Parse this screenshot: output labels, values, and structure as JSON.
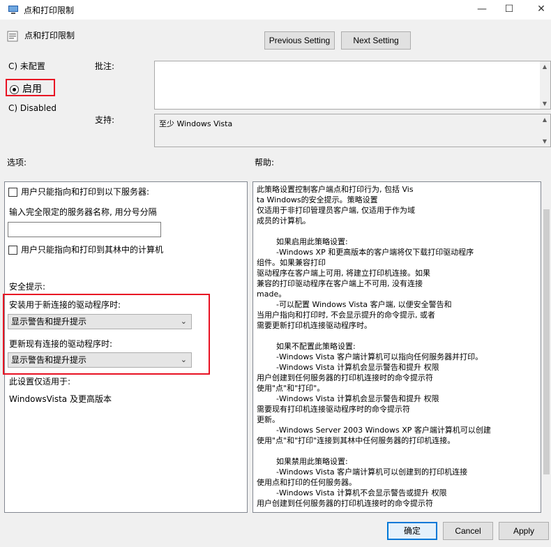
{
  "window": {
    "title": "点和打印限制",
    "minimize": "—",
    "maximize": "☐",
    "close": "✕"
  },
  "header": {
    "policy_title": "点和打印限制",
    "prev_label": "Previous Setting",
    "next_label": "Next Setting"
  },
  "state": {
    "not_configured": "C) 未配置",
    "enabled": "启用",
    "disabled": "C) Disabled"
  },
  "labels": {
    "comment": "批注:",
    "supported": "支持:",
    "options": "选项:",
    "help": "帮助:"
  },
  "supported_value": "至少 Windows Vista",
  "options": {
    "check1": "用户只能指向和打印到以下服务器:",
    "server_prompt": "输入完全限定的服务器名称, 用分号分隔",
    "server_value": "",
    "check2": "用户只能指向和打印到其林中的计算机",
    "security_heading": "安全提示:",
    "new_label": "安装用于新连接的驱动程序时:",
    "new_value": "显示警告和提升提示",
    "update_label": "更新现有连接的驱动程序时:",
    "update_value": "显示警告和提升提示",
    "applies_label": "此设置仅适用于:",
    "applies_value": "WindowsVista 及更高版本"
  },
  "help_text": "此策略设置控制客户端点和打印行为, 包括 Vis\nta Windows的安全提示。策略设置\n仅适用于非打印管理员客户端, 仅适用于作为域\n成员的计算机。\n\n        如果启用此策略设置:\n        -Windows XP 和更高版本的客户端将仅下载打印驱动程序\n组件。如果兼容打印\n驱动程序在客户端上可用, 将建立打印机连接。如果\n兼容的打印驱动程序在客户端上不可用, 没有连接\nmade。\n        -可以配置 Windows Vista 客户端, 以便安全警告和\n当用户指向和打印时, 不会显示提升的命令提示, 或者\n需要更新打印机连接驱动程序时。\n\n        如果不配置此策略设置:\n        -Windows Vista 客户端计算机可以指向任何服务器并打印。\n        -Windows Vista 计算机会显示警告和提升 权限\n用户创建到任何服务器的打印机连接时的命令提示符\n使用\"点\"和\"打印\"。\n        -Windows Vista 计算机会显示警告和提升 权限\n需要现有打印机连接驱动程序时的命令提示符\n更新。\n        -Windows Server 2003 Windows XP 客户端计算机可以创建\n使用\"点\"和\"打印\"连接到其林中任何服务器的打印机连接。\n\n        如果禁用此策略设置:\n        -Windows Vista 客户端计算机可以创建到的打印机连接\n使用点和打印的任何服务器。\n        -Windows Vista 计算机不会显示警告或提升 权限\n用户创建到任何服务器的打印机连接时的命令提示符",
  "footer": {
    "ok": "确定",
    "cancel": "Cancel",
    "apply": "Apply"
  },
  "colors": {
    "highlight": "#e81123",
    "accent": "#0078d7"
  }
}
